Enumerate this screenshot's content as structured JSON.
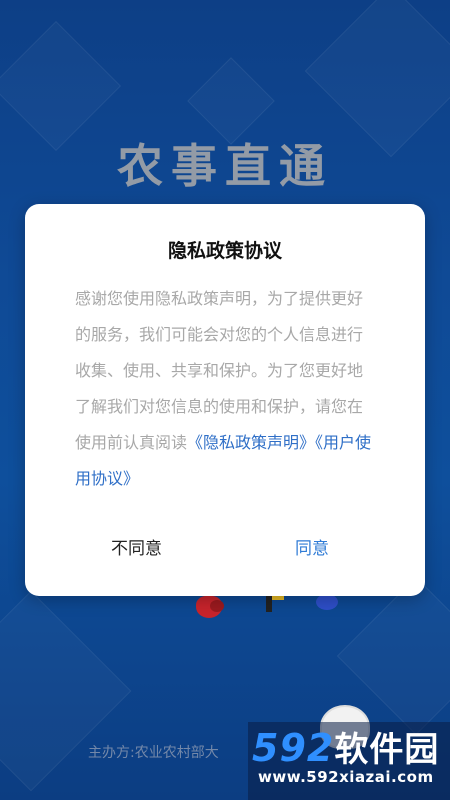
{
  "app": {
    "title": "农事直通",
    "footer": "主办方:农业农村部大"
  },
  "dialog": {
    "title": "隐私政策协议",
    "body_text": "感谢您使用隐私政策声明，为了提供更好的服务，我们可能会对您的个人信息进行收集、使用、共享和保护。为了您更好地了解我们对您信息的使用和保护，请您在使用前认真阅读",
    "link_privacy": "《隐私政策声明》",
    "link_user": "《用户使用协议》",
    "disagree_label": "不同意",
    "agree_label": "同意"
  },
  "watermark": {
    "number": "592",
    "cn": "软件园",
    "url": "www.592xiazai.com"
  },
  "colors": {
    "background": "#0e4a96",
    "link": "#2f6fc7",
    "agree": "#2f7bd6",
    "watermark_number": "#2f8fff"
  },
  "icons": {
    "mascot": "mascot-icon"
  }
}
